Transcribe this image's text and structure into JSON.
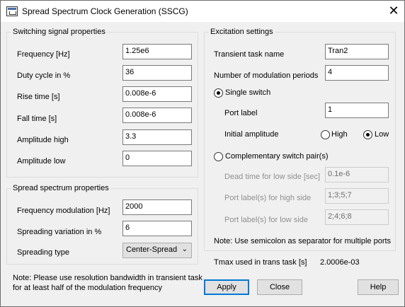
{
  "window": {
    "title": "Spread Spectrum Clock Generation (SSCG)",
    "close_glyph": "✕"
  },
  "switching": {
    "title": "Switching signal properties",
    "fields": [
      {
        "label": "Frequency [Hz]",
        "value": "1.25e6"
      },
      {
        "label": "Duty cycle in %",
        "value": "36"
      },
      {
        "label": "Rise time [s]",
        "value": "0.008e-6"
      },
      {
        "label": "Fall time [s]",
        "value": "0.008e-6"
      },
      {
        "label": "Amplitude high",
        "value": "3.3"
      },
      {
        "label": "Amplitude low",
        "value": "0"
      }
    ]
  },
  "spread": {
    "title": "Spread spectrum properties",
    "freq_mod": {
      "label": "Frequency modulation [Hz]",
      "value": "2000"
    },
    "variation": {
      "label": "Spreading variation in %",
      "value": "6"
    },
    "type": {
      "label": "Spreading type",
      "value": "Center-Spread"
    }
  },
  "excitation": {
    "title": "Excitation settings",
    "task": {
      "label": "Transient task name",
      "value": "Tran2"
    },
    "periods": {
      "label": "Number of modulation periods",
      "value": "4"
    },
    "single": {
      "label": "Single switch",
      "selected": true,
      "port": {
        "label": "Port label",
        "value": "1"
      },
      "initial": {
        "label": "Initial amplitude",
        "high": "High",
        "low": "Low",
        "selected": "Low"
      }
    },
    "complementary": {
      "label": "Complementary switch pair(s)",
      "selected": false,
      "dead_time": {
        "label": "Dead time for low side [sec]",
        "value": "0.1e-6"
      },
      "high_ports": {
        "label": "Port label(s) for high side",
        "value": "1;3;5;7"
      },
      "low_ports": {
        "label": "Port label(s) for low side",
        "value": "2;4;6;8"
      }
    },
    "note": "Note: Use semicolon as separator for multiple ports"
  },
  "tmax": {
    "label": "Tmax used in trans task [s]",
    "value": "2.0006e-03"
  },
  "note": {
    "line1": "Note: Please use resolution bandwidth in transient task",
    "line2": "for at least half of the modulation frequency"
  },
  "buttons": {
    "apply": "Apply",
    "close": "Close",
    "help": "Help"
  },
  "icons": {
    "app": "sscg-app-icon",
    "close": "close-icon",
    "dropdown": "chevron-down-icon"
  },
  "colors": {
    "default_button_border": "#0078d7"
  }
}
